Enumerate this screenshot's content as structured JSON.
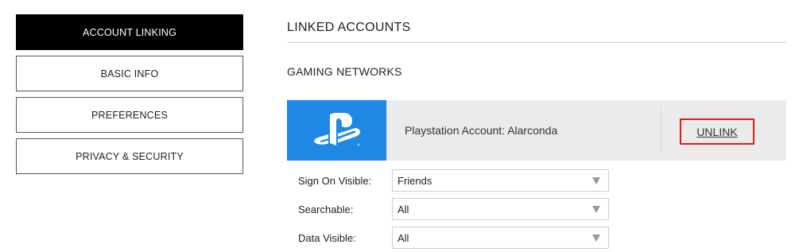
{
  "sidebar": {
    "items": [
      {
        "label": "ACCOUNT LINKING",
        "active": true
      },
      {
        "label": "BASIC INFO",
        "active": false
      },
      {
        "label": "PREFERENCES",
        "active": false
      },
      {
        "label": "PRIVACY & SECURITY",
        "active": false
      }
    ]
  },
  "main": {
    "title": "LINKED ACCOUNTS",
    "subtitle": "GAMING NETWORKS",
    "account": {
      "icon": "playstation-logo-icon",
      "brand_color": "#1e88e5",
      "label": "Playstation Account: Alarconda",
      "unlink_label": "UNLINK",
      "highlight_color": "#e01b1b"
    },
    "settings": [
      {
        "label": "Sign On Visible:",
        "value": "Friends"
      },
      {
        "label": "Searchable:",
        "value": "All"
      },
      {
        "label": "Data Visible:",
        "value": "All"
      }
    ]
  }
}
